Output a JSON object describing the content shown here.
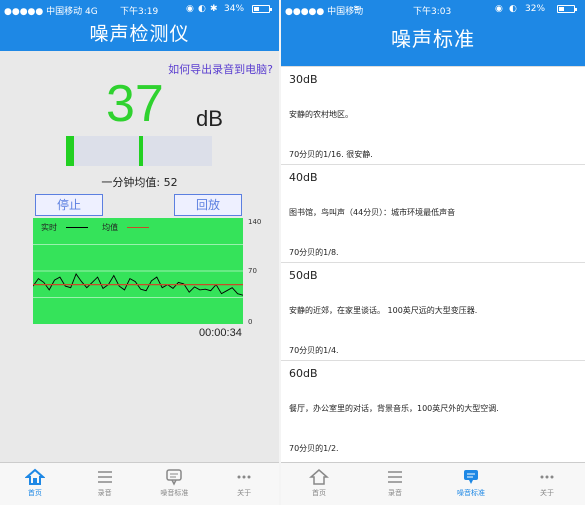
{
  "left": {
    "status": {
      "carrier": "●●●●● 中国移动  4G",
      "time": "下午3:19",
      "battery": "34%",
      "battery_level": 0.34,
      "icons": [
        "location-icon",
        "lock-icon",
        "bluetooth-icon"
      ]
    },
    "title": "噪声检测仪",
    "export_link": "如何导出录音到电脑?",
    "db_value": "37",
    "db_unit": "dB",
    "avg_label": "一分钟均值: 52",
    "stop_button": "停止",
    "replay_button": "回放",
    "timer": "00:00:34"
  },
  "chart_data": {
    "type": "line",
    "legend": [
      "实时",
      "均值"
    ],
    "ylim": [
      0,
      140
    ],
    "yticks": [
      "140",
      "70",
      "0"
    ],
    "series": [
      {
        "name": "实时",
        "color": "#000000",
        "values": [
          50,
          60,
          55,
          45,
          58,
          62,
          50,
          48,
          66,
          56,
          48,
          55,
          62,
          47,
          52,
          64,
          50,
          45,
          60,
          56,
          46,
          44,
          57,
          62,
          48,
          52,
          47,
          55,
          53,
          42,
          49,
          45,
          46,
          44,
          52,
          40,
          44,
          48,
          40,
          38
        ]
      },
      {
        "name": "均值",
        "color": "#c84a28",
        "values": [
          52,
          52,
          52,
          52,
          52,
          52,
          52,
          52,
          52,
          52,
          52,
          52,
          52,
          52,
          52,
          52,
          52,
          52,
          52,
          52,
          52,
          52,
          52,
          52,
          52,
          52,
          52,
          52,
          52,
          52,
          52,
          52,
          52,
          52,
          52,
          52,
          52,
          52,
          52,
          52
        ]
      }
    ],
    "colors": {
      "background": "#35e35a",
      "grid": "#ffffff"
    }
  },
  "right": {
    "status": {
      "carrier": "●●●●● 中国移动",
      "time": "下午3:03",
      "battery": "32%",
      "battery_level": 0.32,
      "icons": [
        "wifi-icon",
        "location-icon",
        "lock-icon"
      ]
    },
    "title": "噪声标准",
    "items": [
      {
        "title": "30dB",
        "desc": "安静的农村地区。",
        "ratio": "70分贝的1/16. 很安静."
      },
      {
        "title": "40dB",
        "desc": "图书馆，鸟叫声（44分贝）：城市环境最低声音",
        "ratio": "70分贝的1/8."
      },
      {
        "title": "50dB",
        "desc": "安静的近郊，在家里谈话。 100英尺远的大型变压器.",
        "ratio": "70分贝的1/4."
      },
      {
        "title": "60dB",
        "desc": "餐厅，办公室里的对话，背景音乐，100英尺外的大型空调.",
        "ratio": "70分贝的1/2."
      }
    ]
  },
  "tabs": {
    "left": [
      {
        "label": "首页",
        "icon": "home-icon",
        "active": true
      },
      {
        "label": "录音",
        "icon": "menu-icon",
        "active": false
      },
      {
        "label": "噪音标准",
        "icon": "chat-icon",
        "active": false
      },
      {
        "label": "关于",
        "icon": "more-icon",
        "active": false
      }
    ],
    "right": [
      {
        "label": "首页",
        "icon": "home-icon",
        "active": false
      },
      {
        "label": "录音",
        "icon": "menu-icon",
        "active": false
      },
      {
        "label": "噪音标准",
        "icon": "chat-icon",
        "active": true
      },
      {
        "label": "关于",
        "icon": "more-icon",
        "active": false
      }
    ]
  },
  "colors": {
    "accent": "#1e88e5",
    "level": "#22d022",
    "link": "#5b3fd0"
  }
}
